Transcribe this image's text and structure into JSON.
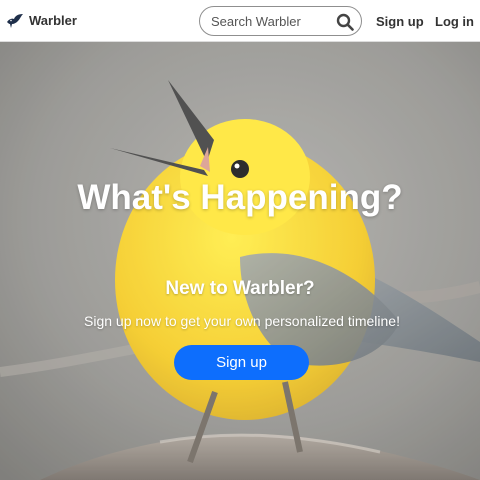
{
  "navbar": {
    "brand": {
      "name": "Warbler",
      "logo_icon": "bird-logo-icon"
    },
    "search": {
      "placeholder": "Search Warbler",
      "value": "",
      "icon": "search-icon"
    },
    "links": {
      "signup": "Sign up",
      "login": "Log in"
    }
  },
  "hero": {
    "background": "photo of a yellow warbler singing on a branch",
    "title": "What's Happening?",
    "subtitle": "New to Warbler?",
    "text": "Sign up now to get your own personalized timeline!",
    "button": "Sign up"
  },
  "colors": {
    "primary_button": "#0d6efd",
    "navbar_text": "#333333",
    "hero_text": "#ffffff"
  }
}
